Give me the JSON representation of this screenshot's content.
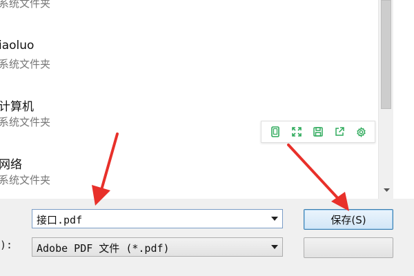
{
  "file_list": {
    "items": [
      {
        "name": "",
        "type": "系统文件夹"
      },
      {
        "name": "iaoluo",
        "type": "系统文件夹"
      },
      {
        "name": "计算机",
        "type": "系统文件夹"
      },
      {
        "name": "网络",
        "type": "系统文件夹"
      }
    ]
  },
  "floating_toolbar": {
    "icons": [
      "mobile-icon",
      "fullscreen-icon",
      "save-icon",
      "share-icon",
      "settings-icon"
    ],
    "accent": "#2eaa5b"
  },
  "form": {
    "filetype_label": "):",
    "filename_value": "接口.pdf",
    "filetype_value": "Adobe PDF 文件 (*.pdf)"
  },
  "buttons": {
    "save_label": "保存(S)",
    "cancel_label": ""
  },
  "colors": {
    "annotation_arrow": "#e8302a"
  }
}
